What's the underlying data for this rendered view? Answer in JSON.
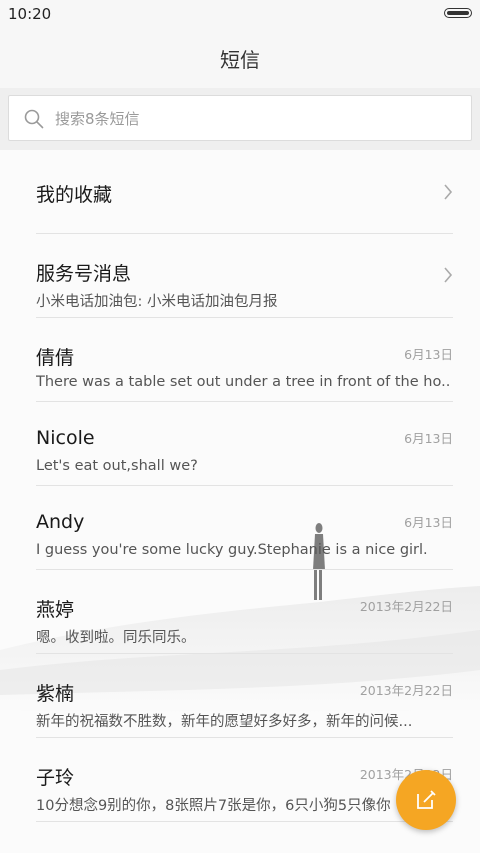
{
  "status_bar": {
    "time": "10:20",
    "icons": [
      "battery-icon"
    ]
  },
  "header": {
    "title": "短信"
  },
  "search": {
    "placeholder": "搜索8条短信",
    "value": "",
    "icon": "search-icon"
  },
  "threads": [
    {
      "name": "我的收藏",
      "preview": "",
      "date": "",
      "icon": "chevron-right-icon"
    },
    {
      "name": "服务号消息",
      "preview": "小米电话加油包: 小米电话加油包月报",
      "date": "",
      "icon": "chevron-right-icon"
    },
    {
      "name": "倩倩",
      "preview": "There was a table set out under a tree in front of the ho..",
      "date": "6月13日"
    },
    {
      "name": "Nicole",
      "preview": "Let's eat out,shall we?",
      "date": "6月13日"
    },
    {
      "name": "Andy",
      "preview": "I guess you're some lucky guy.Stephanie is a nice girl.",
      "date": "6月13日"
    },
    {
      "name": "燕婷",
      "preview": "嗯。收到啦。同乐同乐。",
      "date": "2013年2月22日"
    },
    {
      "name": "紫楠",
      "preview": "新年的祝福数不胜数，新年的愿望好多好多，新年的问候...",
      "date": "2013年2月22日"
    },
    {
      "name": "子玲",
      "preview": "10分想念9别的你，8张照片7张是你，6只小狗5只像你",
      "date": "2013年2月22日"
    }
  ],
  "fab": {
    "icon": "compose-icon",
    "color": "#f5a623"
  }
}
